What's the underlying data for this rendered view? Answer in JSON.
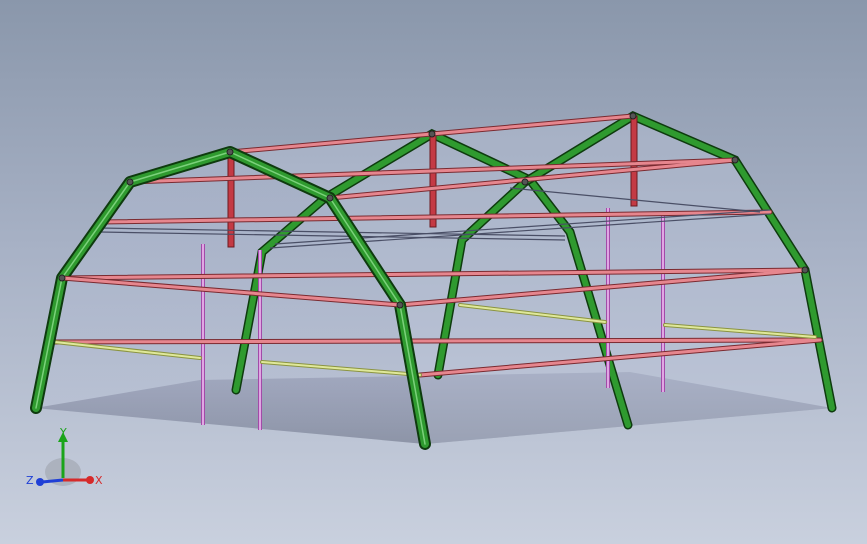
{
  "viewport": {
    "background_top": "#8a97ab",
    "background_bottom": "#c9d0de"
  },
  "colors": {
    "arch_frame": "#2f9a2f",
    "arch_frame_edge": "#0e3b0e",
    "purlin": "#e6868e",
    "purlin_edge": "#7a2a30",
    "brace": "#c9d67a",
    "column": "#d38ad8",
    "ridge_post": "#c43a44",
    "floor": "#8d94ad"
  },
  "triad": {
    "x_label": "X",
    "y_label": "Y",
    "z_label": "Z",
    "x_color": "#d62a2a",
    "y_color": "#1aa41a",
    "z_color": "#1f3fd6"
  }
}
